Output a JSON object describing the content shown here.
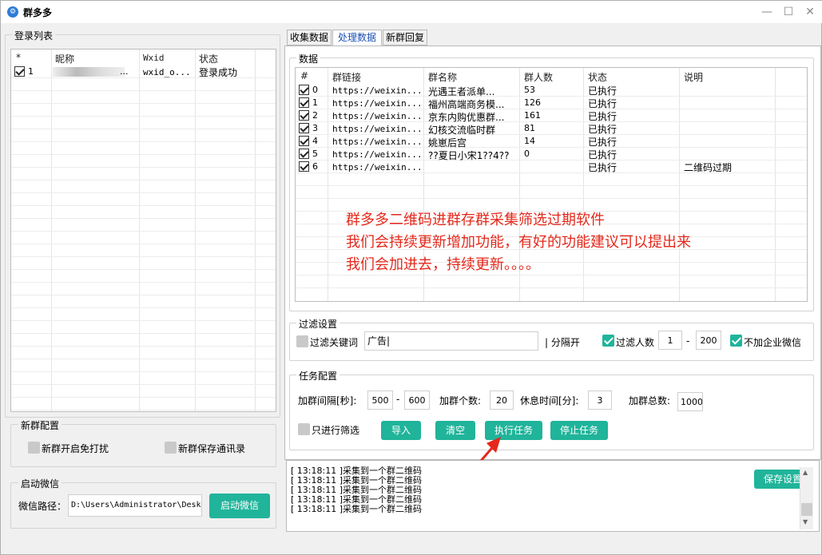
{
  "window": {
    "title": "群多多"
  },
  "login_list": {
    "group_title": "登录列表",
    "headers": [
      "*",
      "昵称",
      "Wxid",
      "状态"
    ],
    "rows": [
      {
        "checked": true,
        "index": "1",
        "nickname": "...",
        "wxid": "wxid_o...",
        "status": "登录成功"
      }
    ]
  },
  "tabs": [
    "收集数据",
    "处理数据",
    "新群回复"
  ],
  "active_tab": 1,
  "data_panel": {
    "group_title": "数据",
    "headers": [
      "#",
      "群链接",
      "群名称",
      "群人数",
      "状态",
      "说明"
    ],
    "rows": [
      {
        "checked": true,
        "index": "0",
        "link": "https://weixin...",
        "name": "光遇王者派单...",
        "count": "53",
        "status": "已执行",
        "note": ""
      },
      {
        "checked": true,
        "index": "1",
        "link": "https://weixin...",
        "name": " 福州高端商务模...",
        "count": "126",
        "status": "已执行",
        "note": ""
      },
      {
        "checked": true,
        "index": "2",
        "link": "https://weixin...",
        "name": " 京东内购优惠群...",
        "count": "161",
        "status": "已执行",
        "note": ""
      },
      {
        "checked": true,
        "index": "3",
        "link": "https://weixin...",
        "name": "幻核交流临时群",
        "count": "81",
        "status": "已执行",
        "note": ""
      },
      {
        "checked": true,
        "index": "4",
        "link": "https://weixin...",
        "name": "姚崽后宫",
        "count": "14",
        "status": "已执行",
        "note": ""
      },
      {
        "checked": true,
        "index": "5",
        "link": "https://weixin...",
        "name": " ??夏日小宋1??4??",
        "count": "0",
        "status": "已执行",
        "note": ""
      },
      {
        "checked": true,
        "index": "6",
        "link": "https://weixin...",
        "name": "",
        "count": "",
        "status": "已执行",
        "note": "二维码过期"
      }
    ],
    "overlay_lines": [
      "群多多二维码进群存群采集筛选过期软件",
      "我们会持续更新增加功能，有好的功能建议可以提出来",
      "我们会加进去，持续更新。。。。"
    ]
  },
  "filter": {
    "group_title": "过滤设置",
    "keyword_label": "过滤关键词",
    "keyword_value": "广告|",
    "separator_label": "| 分隔开",
    "filter_count_label": "过滤人数",
    "count_min": "1",
    "count_max": "200",
    "dash": "-",
    "no_enterprise_label": "不加企业微信"
  },
  "task": {
    "group_title": "任务配置",
    "interval_label": "加群间隔[秒]:",
    "interval_min": "500",
    "interval_max": "600",
    "dash": "-",
    "count_label": "加群个数:",
    "count_value": "20",
    "rest_label": "休息时间[分]:",
    "rest_value": "3",
    "total_label": "加群总数:",
    "total_value": "1000",
    "filter_only_label": "只进行筛选",
    "import_label": "导入",
    "clear_label": "清空",
    "execute_label": "执行任务",
    "stop_label": "停止任务"
  },
  "log": {
    "lines": [
      "[ 13:18:11 ]采集到一个群二维码",
      "[ 13:18:11 ]采集到一个群二维码",
      "[ 13:18:11 ]采集到一个群二维码",
      "[ 13:18:11 ]采集到一个群二维码",
      "[ 13:18:11 ]采集到一个群二维码"
    ],
    "save_label": "保存设置"
  },
  "new_group": {
    "group_title": "新群配置",
    "no_disturb_label": "新群开启免打扰",
    "save_contacts_label": "新群保存通讯录"
  },
  "launch": {
    "group_title": "启动微信",
    "path_label": "微信路径：",
    "path_value": "D:\\Users\\Administrator\\Desktop",
    "launch_label": "启动微信"
  },
  "colors": {
    "accent": "#20b49a",
    "red_text": "#e4281b",
    "active_tab_text": "#1a4fb5"
  }
}
